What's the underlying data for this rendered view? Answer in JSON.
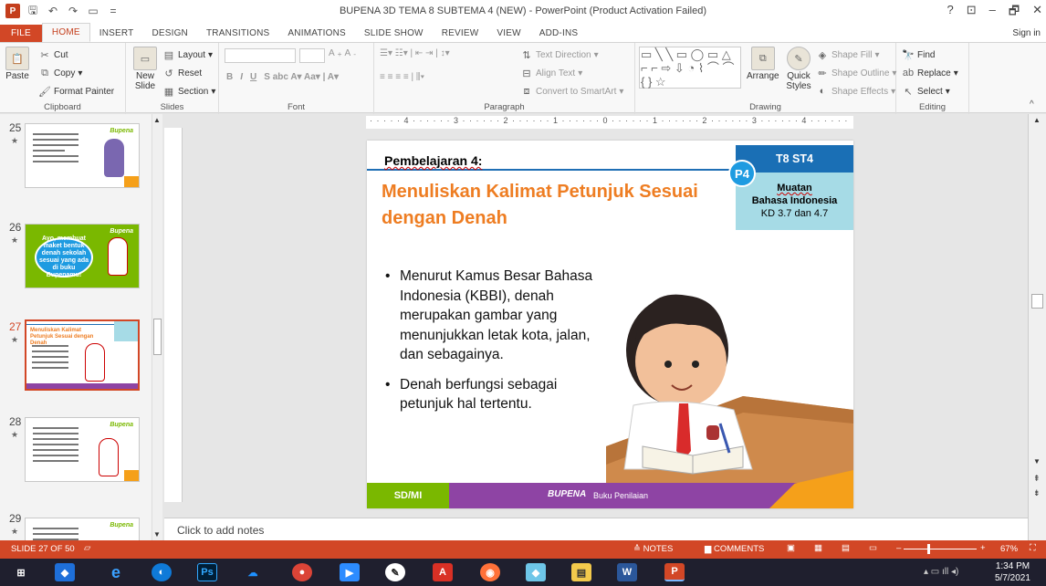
{
  "window": {
    "title": "BUPENA 3D TEMA 8 SUBTEMA 4 (NEW) - PowerPoint (Product Activation Failed)",
    "controls": [
      "?",
      "⊡",
      "–",
      "🗗",
      "✕"
    ]
  },
  "tabs": [
    "FILE",
    "HOME",
    "INSERT",
    "DESIGN",
    "TRANSITIONS",
    "ANIMATIONS",
    "SLIDE SHOW",
    "REVIEW",
    "VIEW",
    "ADD-INS"
  ],
  "signin": "Sign in",
  "ribbon": {
    "clipboard": {
      "label": "Clipboard",
      "paste": "Paste",
      "cut": "Cut",
      "copy": "Copy",
      "format_painter": "Format Painter"
    },
    "slides": {
      "label": "Slides",
      "new_slide": "New Slide",
      "layout": "Layout",
      "reset": "Reset",
      "section": "Section"
    },
    "font": {
      "label": "Font"
    },
    "paragraph": {
      "label": "Paragraph",
      "text_direction": "Text Direction",
      "align_text": "Align Text",
      "convert_smartart": "Convert to SmartArt"
    },
    "drawing": {
      "label": "Drawing",
      "arrange": "Arrange",
      "quick_styles": "Quick Styles",
      "shape_fill": "Shape Fill",
      "shape_outline": "Shape Outline",
      "shape_effects": "Shape Effects"
    },
    "editing": {
      "label": "Editing",
      "find": "Find",
      "replace": "Replace",
      "select": "Select"
    }
  },
  "thumbnails": [
    {
      "num": "25",
      "text": "Jika digunakan untuk menggambarkan sebuah wilayah"
    },
    {
      "num": "26",
      "text": "Ayo, membuat maket bentuk denah sekolah sesuai yang ada di buku Bupenamu!"
    },
    {
      "num": "27",
      "text": "Menuliskan Kalimat Petunjuk Sesuai dengan Denah"
    },
    {
      "num": "28",
      "text": "Untuk menemukan tempat pada denah"
    },
    {
      "num": "29",
      "text": "Setelah membaca denah"
    }
  ],
  "ruler": {
    "horizontal": "· · · · · 4 · · · · · · 3 · · · · · · 2 · · · · · · 1 · · · · · · 0 · · · · · · 1 · · · · · · 2 · · · · · · 3 · · · · · · 4 · · · · · ·"
  },
  "slide": {
    "pembelajaran": "Pembelajaran 4:",
    "title": "Menuliskan Kalimat Petunjuk Sesuai dengan Denah",
    "tag": "T8  ST4",
    "badge": "P4",
    "muatan": "Muatan",
    "subject": "Bahasa Indonesia",
    "kd": "KD 3.7 dan 4.7",
    "bullets": [
      "Menurut Kamus Besar Bahasa Indonesia (KBBI), denah merupakan gambar yang menunjukkan letak kota, jalan, dan sebagainya.",
      "Denah berfungsi sebagai petunjuk hal tertentu."
    ],
    "footer_level": "SD/MI",
    "footer_brand": "BUPENA",
    "footer_book": "Buku Penilaian"
  },
  "notes_placeholder": "Click to add notes",
  "status": {
    "slide": "SLIDE 27 OF 50",
    "notes": "NOTES",
    "comments": "COMMENTS",
    "zoom": "67%"
  },
  "taskbar": {
    "time": "1:34 PM",
    "date": "5/7/2021"
  }
}
